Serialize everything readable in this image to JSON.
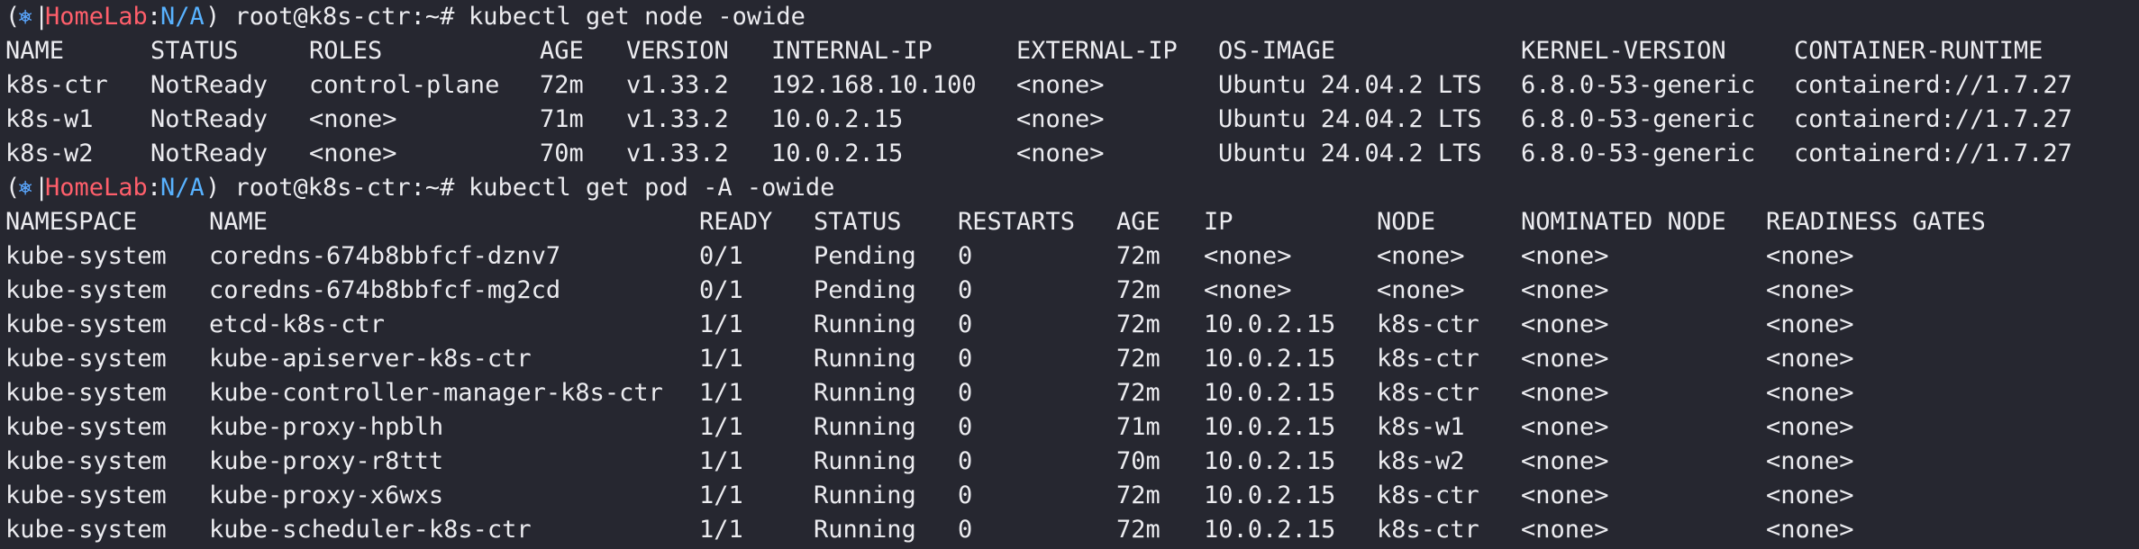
{
  "prompt": {
    "open_paren": "(",
    "icon": "⎈",
    "icon_name": "kubernetes-icon",
    "bar": "|",
    "context": "HomeLab",
    "colon": ":",
    "namespace": "N/A",
    "close": ") root@k8s-ctr:~#",
    "colors": {
      "context": "#ff5f6b",
      "namespace": "#58b2ff",
      "icon": "#5aa7ff"
    }
  },
  "commands": [
    "kubectl get node -owide",
    "kubectl get pod -A -owide"
  ],
  "nodes": {
    "headers": [
      "NAME",
      "STATUS",
      "ROLES",
      "AGE",
      "VERSION",
      "INTERNAL-IP",
      "EXTERNAL-IP",
      "OS-IMAGE",
      "KERNEL-VERSION",
      "CONTAINER-RUNTIME"
    ],
    "rows": [
      [
        "k8s-ctr",
        "NotReady",
        "control-plane",
        "72m",
        "v1.33.2",
        "192.168.10.100",
        "<none>",
        "Ubuntu 24.04.2 LTS",
        "6.8.0-53-generic",
        "containerd://1.7.27"
      ],
      [
        "k8s-w1",
        "NotReady",
        "<none>",
        "71m",
        "v1.33.2",
        "10.0.2.15",
        "<none>",
        "Ubuntu 24.04.2 LTS",
        "6.8.0-53-generic",
        "containerd://1.7.27"
      ],
      [
        "k8s-w2",
        "NotReady",
        "<none>",
        "70m",
        "v1.33.2",
        "10.0.2.15",
        "<none>",
        "Ubuntu 24.04.2 LTS",
        "6.8.0-53-generic",
        "containerd://1.7.27"
      ]
    ]
  },
  "pods": {
    "headers": [
      "NAMESPACE",
      "NAME",
      "READY",
      "STATUS",
      "RESTARTS",
      "AGE",
      "IP",
      "NODE",
      "NOMINATED NODE",
      "READINESS GATES"
    ],
    "rows": [
      [
        "kube-system",
        "coredns-674b8bbfcf-dznv7",
        "0/1",
        "Pending",
        "0",
        "72m",
        "<none>",
        "<none>",
        "<none>",
        "<none>"
      ],
      [
        "kube-system",
        "coredns-674b8bbfcf-mg2cd",
        "0/1",
        "Pending",
        "0",
        "72m",
        "<none>",
        "<none>",
        "<none>",
        "<none>"
      ],
      [
        "kube-system",
        "etcd-k8s-ctr",
        "1/1",
        "Running",
        "0",
        "72m",
        "10.0.2.15",
        "k8s-ctr",
        "<none>",
        "<none>"
      ],
      [
        "kube-system",
        "kube-apiserver-k8s-ctr",
        "1/1",
        "Running",
        "0",
        "72m",
        "10.0.2.15",
        "k8s-ctr",
        "<none>",
        "<none>"
      ],
      [
        "kube-system",
        "kube-controller-manager-k8s-ctr",
        "1/1",
        "Running",
        "0",
        "72m",
        "10.0.2.15",
        "k8s-ctr",
        "<none>",
        "<none>"
      ],
      [
        "kube-system",
        "kube-proxy-hpblh",
        "1/1",
        "Running",
        "0",
        "71m",
        "10.0.2.15",
        "k8s-w1",
        "<none>",
        "<none>"
      ],
      [
        "kube-system",
        "kube-proxy-r8ttt",
        "1/1",
        "Running",
        "0",
        "70m",
        "10.0.2.15",
        "k8s-w2",
        "<none>",
        "<none>"
      ],
      [
        "kube-system",
        "kube-proxy-x6wxs",
        "1/1",
        "Running",
        "0",
        "72m",
        "10.0.2.15",
        "k8s-ctr",
        "<none>",
        "<none>"
      ],
      [
        "kube-system",
        "kube-scheduler-k8s-ctr",
        "1/1",
        "Running",
        "0",
        "72m",
        "10.0.2.15",
        "k8s-ctr",
        "<none>",
        "<none>"
      ]
    ]
  }
}
